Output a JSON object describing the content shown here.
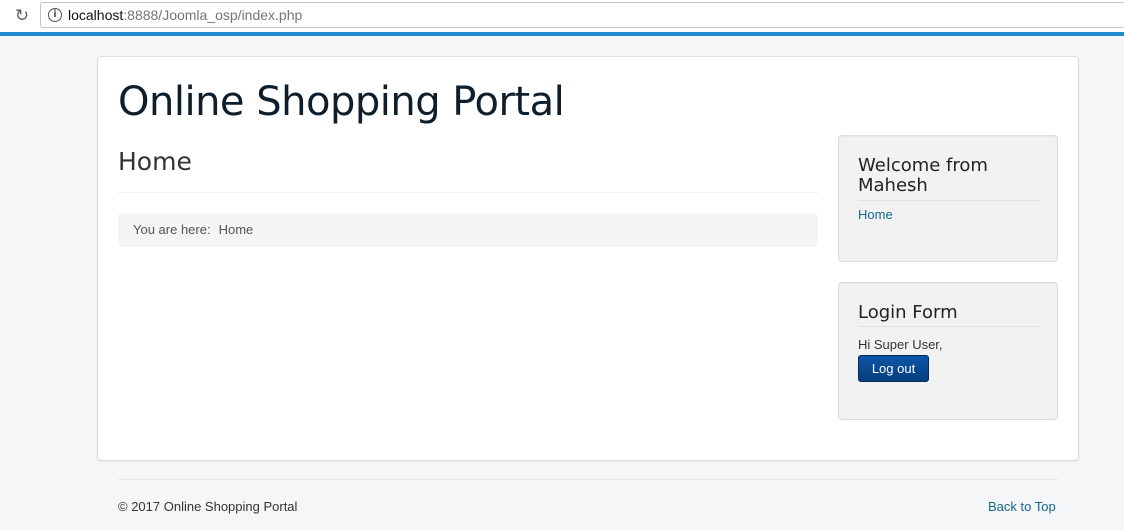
{
  "browser": {
    "url_host": "localhost",
    "url_rest": ":8888/Joomla_osp/index.php",
    "reload_icon": "reload-icon",
    "info_icon": "info-icon"
  },
  "site": {
    "title": "Online Shopping Portal"
  },
  "main": {
    "page_heading": "Home",
    "breadcrumb_label": "You are here:",
    "breadcrumb_current": "Home"
  },
  "sidebar": {
    "welcome_module": {
      "title": "Welcome from Mahesh",
      "menu_items": [
        "Home"
      ]
    },
    "login_module": {
      "title": "Login Form",
      "greeting": "Hi Super User,",
      "logout_label": "Log out"
    }
  },
  "footer": {
    "copyright": "© 2017 Online Shopping Portal",
    "back_to_top": "Back to Top"
  },
  "colors": {
    "accent_bar": "#1c8bd0",
    "link": "#15668f",
    "button": "#0a4b95"
  }
}
